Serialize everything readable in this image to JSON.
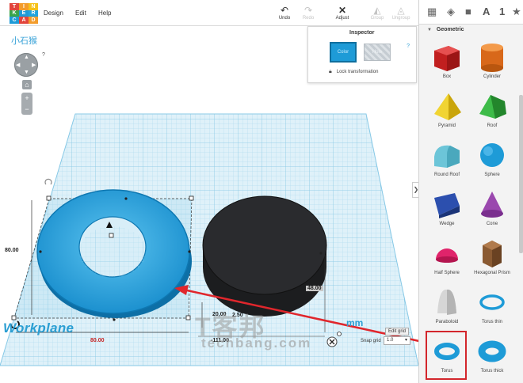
{
  "app": {
    "logo_letters": [
      "TIN",
      "KER",
      "CAD"
    ],
    "logo_colors": [
      "#e2443b",
      "#f39c2b",
      "#f6c21a",
      "#3aa54a",
      "#1e9bd7",
      "#20a4e0",
      "#1e9bd7",
      "#e2443b",
      "#f39c2b"
    ]
  },
  "menu": {
    "design": "Design",
    "edit": "Edit",
    "help": "Help"
  },
  "toolbar": {
    "undo": "Undo",
    "redo": "Redo",
    "adjust": "Adjust",
    "group": "Group",
    "ungroup": "Ungroup"
  },
  "project": {
    "name": "小石猴"
  },
  "inspector": {
    "title": "Inspector",
    "help": "?",
    "color_label": "Color",
    "hole_label": "Hole",
    "lock_label": "Lock transformation"
  },
  "dimensions": {
    "width": "80.00",
    "depth": "80.00",
    "height": "20,00",
    "elevation": "2.50",
    "offset_x": "-111.00",
    "offset_y": "48.00"
  },
  "workplane": {
    "label": "Workplane",
    "unit": "mm",
    "edit_grid": "Edit grid",
    "snap_label": "Snap grid",
    "snap_value": "1.0"
  },
  "watermark": {
    "main": "T客邦",
    "sub": "techbang.com"
  },
  "sidebar": {
    "section": "Geometric",
    "top_icons": [
      "grid-icon",
      "cube-icon",
      "box-icon",
      "A",
      "1",
      "star-icon"
    ],
    "shapes": [
      {
        "label": "Box",
        "color": "#d62b2b"
      },
      {
        "label": "Cylinder",
        "color": "#e8761e"
      },
      {
        "label": "Pyramid",
        "color": "#e9c714"
      },
      {
        "label": "Roof",
        "color": "#2ea33a"
      },
      {
        "label": "Round Roof",
        "color": "#6fc8d8"
      },
      {
        "label": "Sphere",
        "color": "#1e9bd7"
      },
      {
        "label": "Wedge",
        "color": "#23429a"
      },
      {
        "label": "Cone",
        "color": "#8e3ea0"
      },
      {
        "label": "Half Sphere",
        "color": "#e0246b"
      },
      {
        "label": "Hexagonal Prism",
        "color": "#8a5a32"
      },
      {
        "label": "Paraboloid",
        "color": "#d8d8d8"
      },
      {
        "label": "Torus thin",
        "color": "#1e9bd7"
      },
      {
        "label": "Torus",
        "color": "#1e9bd7"
      },
      {
        "label": "Torus thick",
        "color": "#1e9bd7"
      }
    ]
  }
}
